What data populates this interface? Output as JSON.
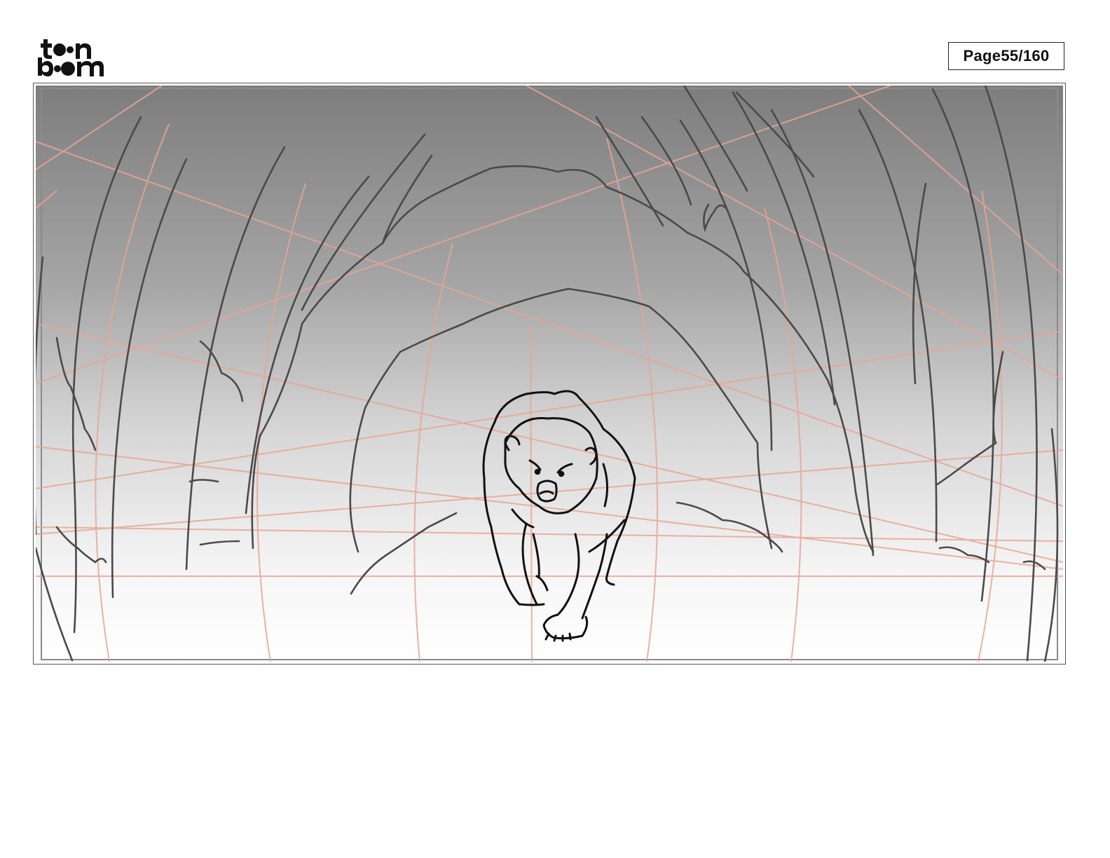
{
  "header": {
    "logo": {
      "line1": "toon",
      "line2": "boom",
      "icon": "toon-boom-logo"
    },
    "page_label": "Page",
    "page_number": "55/160"
  },
  "panel": {
    "icon": "storyboard-panel-drawing",
    "sketch_subject": "bear-walking-out-of-cave",
    "colors": {
      "sky_top": "#7f7f7f",
      "ground_bottom": "#ffffff",
      "sketch_line": "#4a4a4a",
      "character_line": "#111111",
      "perspective_guide": "#e8a595"
    }
  }
}
